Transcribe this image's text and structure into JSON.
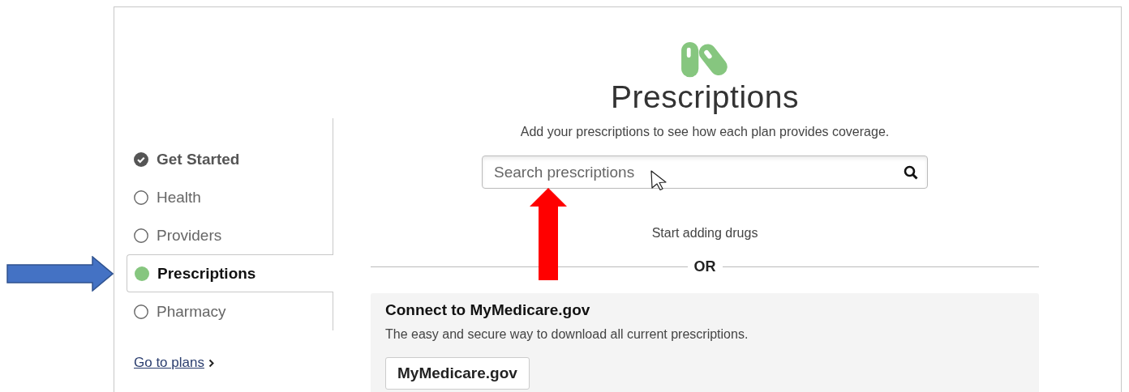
{
  "header": {
    "title": "Prescriptions",
    "subtitle": "Add your prescriptions to see how each plan provides coverage."
  },
  "search": {
    "placeholder": "Search prescriptions"
  },
  "steps": [
    {
      "label": "Get Started",
      "kind": "complete",
      "selected": false
    },
    {
      "label": "Health",
      "kind": "incomplete",
      "selected": false
    },
    {
      "label": "Providers",
      "kind": "incomplete",
      "selected": false
    },
    {
      "label": "Prescriptions",
      "kind": "current",
      "selected": true
    },
    {
      "label": "Pharmacy",
      "kind": "incomplete",
      "selected": false
    }
  ],
  "go_to_plans": {
    "label": "Go to plans"
  },
  "empty_state": "Start adding drugs",
  "divider_label": "OR",
  "connect_card": {
    "title": "Connect to MyMedicare.gov",
    "description": "The easy and secure way to download all current prescriptions.",
    "button": "MyMedicare.gov"
  }
}
